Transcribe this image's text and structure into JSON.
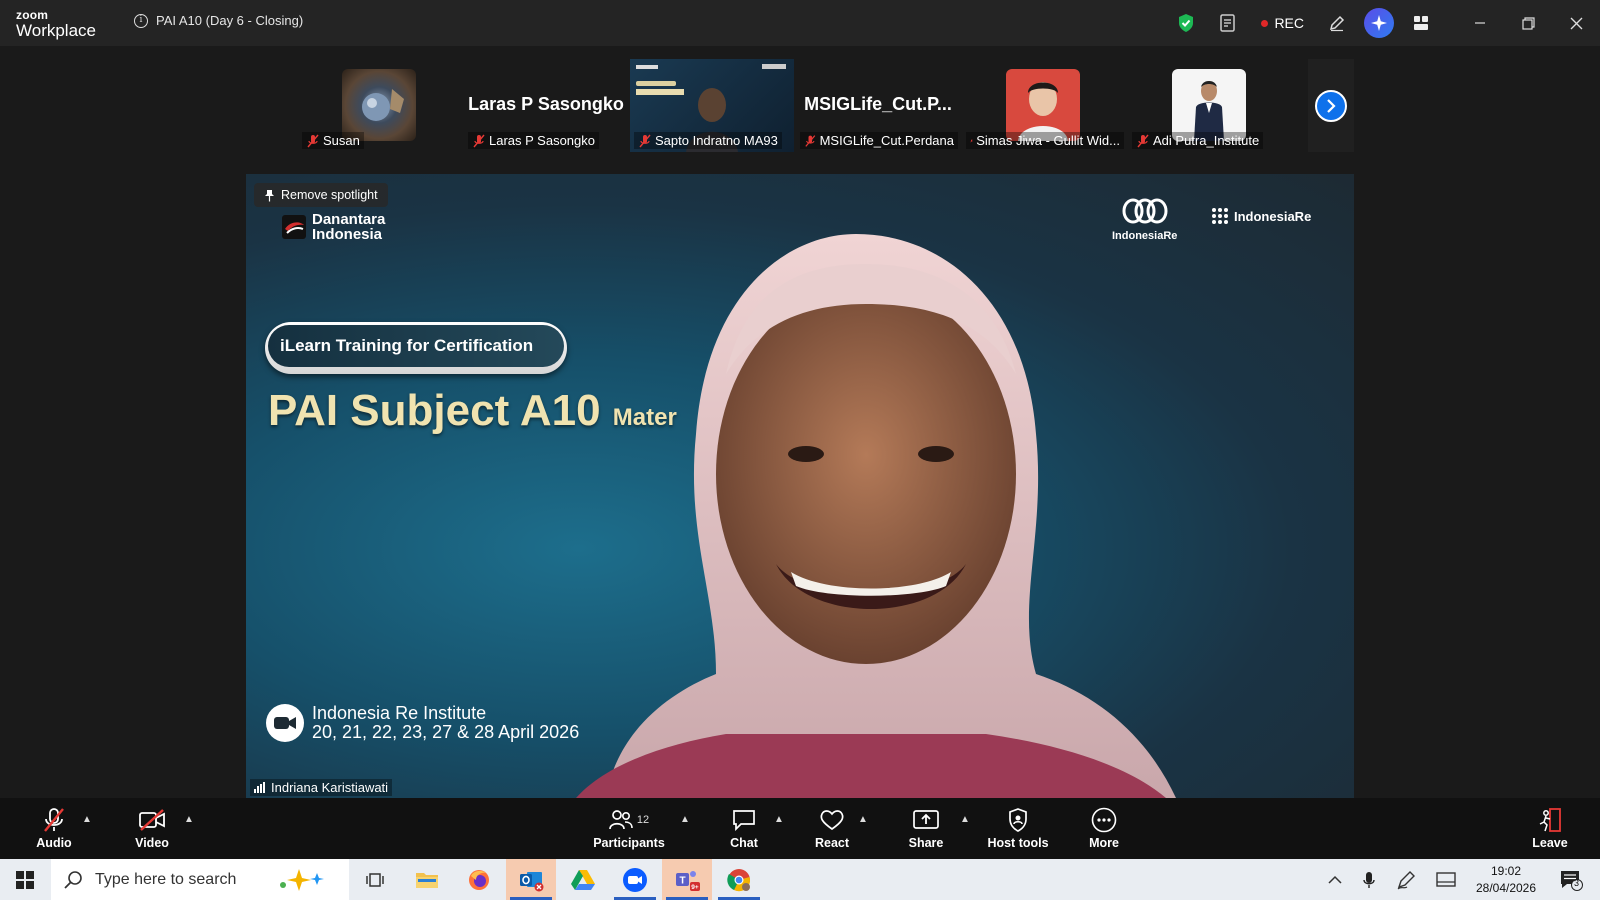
{
  "window": {
    "brand_top": "zoom",
    "brand_bottom": "Workplace",
    "meeting_title": "PAI A10 (Day 6 - Closing)",
    "rec_label": "REC"
  },
  "gallery": {
    "tiles": [
      {
        "name": "Susan",
        "type": "photo"
      },
      {
        "name": "Laras P Sasongko",
        "display_name": "Laras P Sasongko",
        "type": "name"
      },
      {
        "name": "Sapto Indratno MA93",
        "type": "video"
      },
      {
        "name": "MSIGLife_Cut.Perdana",
        "display_name": "MSIGLife_Cut.P...",
        "type": "name"
      },
      {
        "name": "Simas Jiwa - Gullit Wid...",
        "type": "photo"
      },
      {
        "name": "Adi Putra_Institute",
        "type": "photo"
      }
    ]
  },
  "spotlight": {
    "remove_label": "Remove spotlight",
    "speaker_name": "Indriana Karistiawati",
    "slide": {
      "org_logo_line1": "Danantara",
      "org_logo_line2": "Indonesia",
      "logo_right_1": "IndonesiaRe",
      "logo_right_2": "IndonesiaRe",
      "pill_text": "iLearn Training for Certification",
      "title": "PAI Subject A10",
      "title_suffix": "Mater",
      "event_line1": "Indonesia Re Institute",
      "event_line2": "20, 21, 22, 23, 27 & 28 April 2026"
    }
  },
  "toolbar": {
    "audio": "Audio",
    "video": "Video",
    "participants": "Participants",
    "participants_count": "12",
    "chat": "Chat",
    "react": "React",
    "share": "Share",
    "host_tools": "Host tools",
    "more": "More",
    "leave": "Leave"
  },
  "taskbar": {
    "search_placeholder": "Type here to search",
    "time": "19:02",
    "date": "28/04/2026",
    "notification_count": "3"
  },
  "colors": {
    "accent_blue": "#0e71eb",
    "rec_red": "#e02828",
    "shield_green": "#1db954",
    "leave_red": "#e02828"
  }
}
